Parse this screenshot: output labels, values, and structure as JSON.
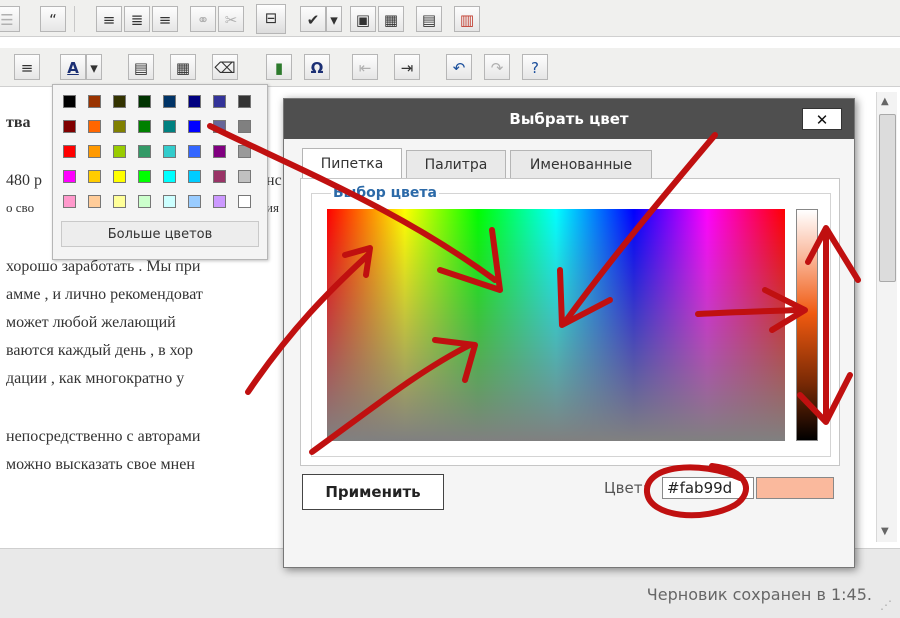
{
  "editor": {
    "lines": [
      "тва",
      "480 р",
      "о сво",
      "хорошо   заработать . Мы при",
      "амме  , и лично рекомендоват",
      "   может любой желающий",
      "ваются   каждый день , в хор",
      "дации  , как многократно  у",
      "непосредственно   с авторами",
      " можно высказать свое мнен"
    ],
    "fragment_top": "нс",
    "fragment_mid": "ия"
  },
  "dropdown": {
    "more_label": "Больше цветов",
    "swatches": [
      [
        "#000000",
        "#993300",
        "#333300",
        "#003300",
        "#003366",
        "#000080",
        "#333399",
        "#333333"
      ],
      [
        "#800000",
        "#ff6600",
        "#808000",
        "#008000",
        "#008080",
        "#0000ff",
        "#666699",
        "#808080"
      ],
      [
        "#ff0000",
        "#ff9900",
        "#99cc00",
        "#339966",
        "#33cccc",
        "#3366ff",
        "#800080",
        "#999999"
      ],
      [
        "#ff00ff",
        "#ffcc00",
        "#ffff00",
        "#00ff00",
        "#00ffff",
        "#00ccff",
        "#993366",
        "#c0c0c0"
      ],
      [
        "#ff99cc",
        "#ffcc99",
        "#ffff99",
        "#ccffcc",
        "#ccffff",
        "#99ccff",
        "#cc99ff",
        "#ffffff"
      ]
    ]
  },
  "dialog": {
    "title": "Выбрать цвет",
    "close_label": "✕",
    "tabs": [
      "Пипетка",
      "Палитра",
      "Именованные"
    ],
    "group_legend": "Выбор цвета",
    "apply_label": "Применить",
    "color_label": "Цвет:",
    "color_value": "#fab99d",
    "preview_color": "#fab99d"
  },
  "status": {
    "text": "Черновик сохранен в 1:45."
  },
  "toolbar": {
    "row1": [
      "list-icon",
      "quote-icon",
      "align-left-icon",
      "align-center-icon",
      "align-right-icon",
      "link-icon",
      "unlink-icon",
      "page-break-icon",
      "spellcheck-icon",
      "dropdown-icon",
      "fullscreen-icon",
      "keyboard-icon",
      "media-icon",
      "chart-icon"
    ],
    "row2": [
      "justify-icon",
      "text-color-icon",
      "dropdown-icon",
      "paste-text-icon",
      "paste-word-icon",
      "eraser-icon",
      "embed-icon",
      "omega-icon",
      "outdent-icon",
      "indent-icon",
      "undo-icon",
      "redo-icon",
      "help-icon"
    ]
  }
}
